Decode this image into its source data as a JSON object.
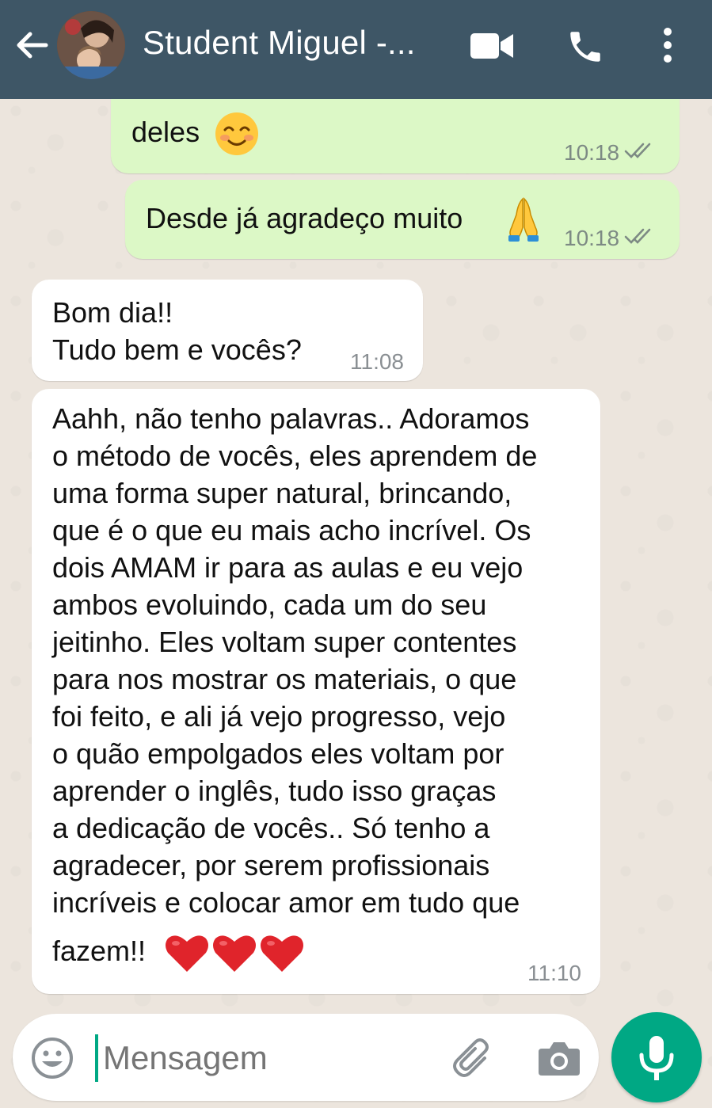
{
  "header": {
    "contact_name": "Student Miguel -...",
    "back_icon": "arrow-left-icon",
    "video_icon": "video-camera-icon",
    "call_icon": "phone-icon",
    "menu_icon": "more-vertical-icon",
    "background_color": "#3e5666"
  },
  "messages": [
    {
      "direction": "out",
      "text": "deles",
      "emoji": "smiling-face-icon",
      "time": "10:18",
      "status": "read-ticks"
    },
    {
      "direction": "out",
      "text": "Desde já agradeço muito",
      "emoji": "folded-hands-icon",
      "time": "10:18",
      "status": "read-ticks"
    },
    {
      "direction": "in",
      "text": "Bom dia!!\nTudo bem e vocês?",
      "time": "11:08"
    },
    {
      "direction": "in",
      "text": "Aahh, não tenho palavras.. Adoramos\no método de vocês, eles aprendem de\numa forma super natural, brincando,\nque é o que eu mais acho incrível. Os\ndois AMAM ir para as aulas e eu vejo\nambos evoluindo, cada um do seu\njeitinho. Eles voltam super contentes\npara nos mostrar os materiais, o que\nfoi feito, e ali já vejo progresso, vejo\no quão empolgados eles voltam por\naprender o inglês, tudo isso graças\na dedicação de vocês.. Só tenho a\nagradecer, por serem profissionais\nincríveis e colocar amor em tudo que",
      "last_line": "fazem!!",
      "emoji": "red-heart-icon x3",
      "time": "11:10"
    }
  ],
  "composer": {
    "placeholder": "Mensagem",
    "emoji_icon": "emoji-icon",
    "attach_icon": "paperclip-icon",
    "camera_icon": "camera-icon",
    "mic_icon": "microphone-icon"
  },
  "colors": {
    "outgoing_bubble": "#dcf8c6",
    "incoming_bubble": "#ffffff",
    "accent": "#00a884",
    "chat_background": "#ece5dd"
  }
}
